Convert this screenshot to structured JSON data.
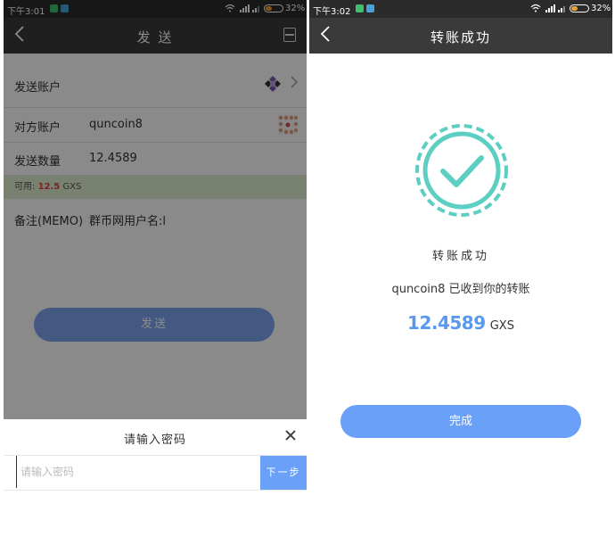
{
  "left_screen": {
    "status": {
      "time": "下午3:01",
      "battery": "32%"
    },
    "nav": {
      "title": "发 送"
    },
    "form": {
      "send_account_label": "发送账户",
      "recipient_label": "对方账户",
      "recipient_value": "quncoin8",
      "amount_label": "发送数量",
      "amount_value": "12.4589",
      "available_prefix": "可用:",
      "available_value": "12.5",
      "available_unit": "GXS",
      "memo_label": "备注(MEMO)",
      "memo_value": "群币网用户名:l"
    },
    "send_button": "发送",
    "password_panel": {
      "title": "请输入密码",
      "placeholder": "请输入密码",
      "next_button": "下一步"
    }
  },
  "right_screen": {
    "status": {
      "time": "下午3:02",
      "battery": "32%"
    },
    "nav": {
      "title": "转账成功"
    },
    "success_title": "转账成功",
    "message": "quncoin8  已收到你的转账",
    "amount": "12.4589",
    "unit": "GXS",
    "done_button": "完成"
  },
  "colors": {
    "accent": "#6aa0f8",
    "success": "#5ccfc2",
    "navbar": "#3a3a3a",
    "available_bg": "#dff0d0"
  },
  "icons": [
    "back-arrow-icon",
    "scan-icon",
    "chevron-right-icon",
    "close-icon",
    "success-check-icon",
    "identicon"
  ]
}
